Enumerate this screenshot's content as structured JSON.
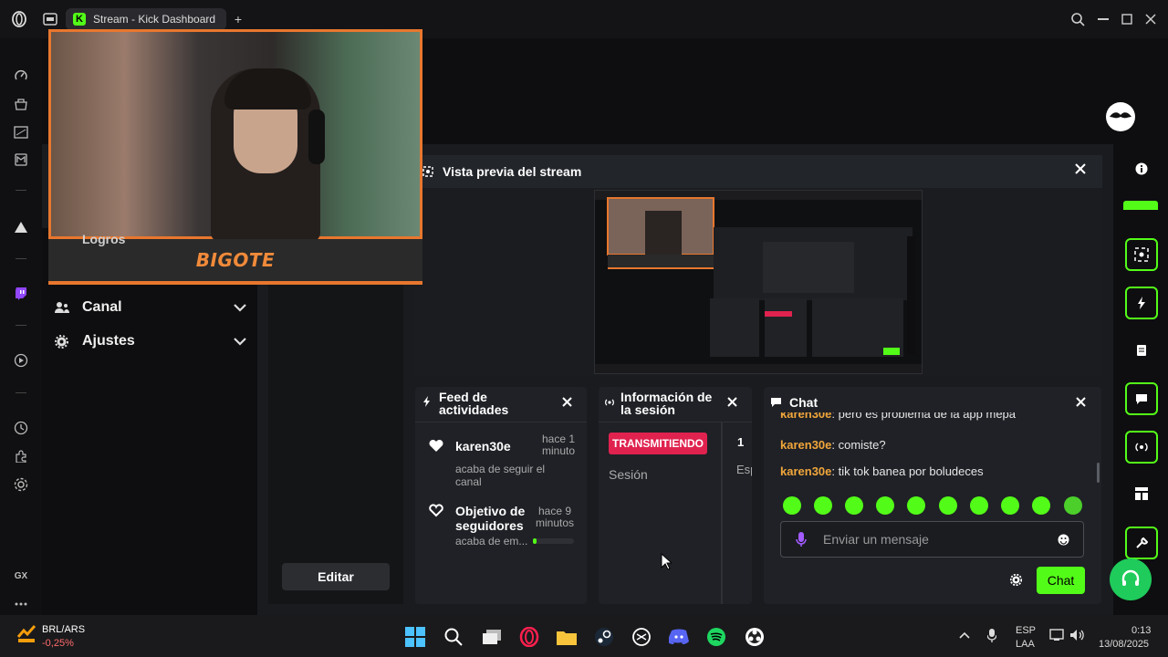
{
  "browser": {
    "tab_title": "Stream - Kick Dashboard",
    "tab_favicon_letter": "K",
    "new_tab_glyph": "+",
    "gx_label": "GX"
  },
  "webcam": {
    "label": "BIGOTE",
    "overlay_color": "#e8772e"
  },
  "leftnav": {
    "logros": "Logros",
    "items": [
      {
        "label": "Canal",
        "icon": "users-icon"
      },
      {
        "label": "Ajustes",
        "icon": "gear-icon"
      }
    ],
    "edit_button": "Editar"
  },
  "preview": {
    "title": "Vista previa del stream"
  },
  "feed": {
    "title": "Feed de actividades",
    "items": [
      {
        "user": "karen30e",
        "time": "hace 1 minuto",
        "desc": "acaba de seguir el canal",
        "icon": "heart-filled-icon"
      },
      {
        "user": "Objetivo de seguidores",
        "time": "hace 9 minutos",
        "desc": "acaba de em...",
        "icon": "heart-outline-icon",
        "progress": 0.07
      }
    ]
  },
  "session": {
    "title": "Información de la sesión",
    "status": "TRANSMITIENDO",
    "label": "Sesión",
    "side_value": "1",
    "side_label": "Esp"
  },
  "chat": {
    "title": "Chat",
    "messages": [
      {
        "user": "karen30e",
        "text": ": pero es problema de la app mepa"
      },
      {
        "user": "karen30e",
        "text": ": comiste?"
      },
      {
        "user": "karen30e",
        "text": ": tik tok banea por boludeces"
      }
    ],
    "input_placeholder": "Enviar un mensaje",
    "send_button": "Chat"
  },
  "taskbar": {
    "ticker_symbol": "BRL/ARS",
    "ticker_change": "-0,25%",
    "language": "ESP",
    "layout": "LAA",
    "time": "0:13",
    "date": "13/08/2025"
  },
  "colors": {
    "kick_green": "#53fc18",
    "live_red": "#e0224f",
    "username": "#f1a63b"
  }
}
